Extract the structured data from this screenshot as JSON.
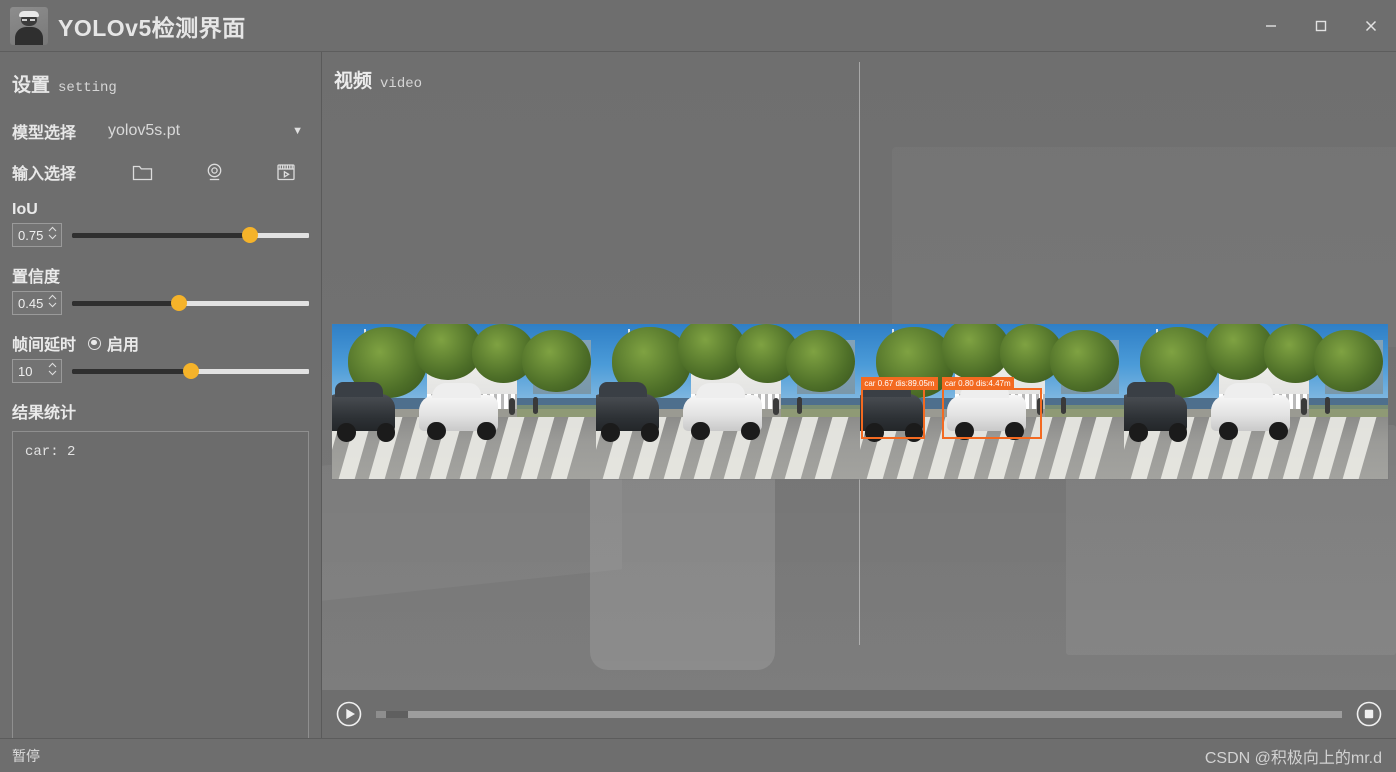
{
  "window": {
    "title": "YOLOv5检测界面",
    "logo_icon": "person-avatar-icon",
    "minimize_label": "−",
    "maximize_label": "□",
    "close_label": "×"
  },
  "sidebar": {
    "heading_cn": "设置",
    "heading_en": "setting",
    "model": {
      "label": "模型选择",
      "value": "yolov5s.pt",
      "caret_icon": "chevron-down-icon"
    },
    "input": {
      "label": "输入选择",
      "buttons": [
        {
          "icon": "folder-icon",
          "name": "open-file-button"
        },
        {
          "icon": "webcam-icon",
          "name": "open-camera-button"
        },
        {
          "icon": "video-file-icon",
          "name": "open-video-button"
        }
      ]
    },
    "iou": {
      "label": "IoU",
      "value": "0.75",
      "percent": 75
    },
    "conf": {
      "label": "置信度",
      "value": "0.45",
      "percent": 45
    },
    "delay": {
      "label": "帧间延时",
      "radio_label": "启用",
      "radio_checked": true,
      "value": "10",
      "percent": 50
    },
    "results": {
      "label": "结果统计",
      "lines": [
        "car: 2"
      ]
    }
  },
  "video": {
    "heading_cn": "视频",
    "heading_en": "video",
    "player": {
      "play_icon": "play-circle-icon",
      "stop_icon": "stop-circle-icon",
      "progress_percent": 1
    },
    "detections": [
      {
        "class": "car",
        "confidence": "0.67",
        "distance": "dis:89.05m",
        "label": "car 0.67  dis:89.05m"
      },
      {
        "class": "car",
        "confidence": "0.80",
        "distance": "dis:4.47m",
        "label": "car 0.80  dis:4.47m"
      }
    ],
    "frames_count": 4
  },
  "status": {
    "text": "暂停",
    "watermark": "CSDN @积极向上的mr.d"
  },
  "colors": {
    "accent": "#f5b32a",
    "detection_box": "#f36a21",
    "panel_bg": "#6e6e6e",
    "text": "#e8e8e8"
  }
}
